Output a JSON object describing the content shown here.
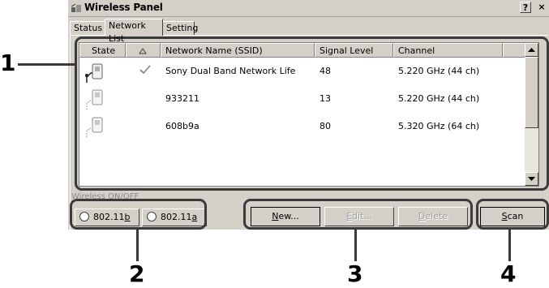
{
  "window": {
    "title": "Wireless Panel",
    "help_button": "?",
    "close_button": "×"
  },
  "tabs": [
    {
      "label": "Status",
      "active": false
    },
    {
      "label": "Network List",
      "active": true
    },
    {
      "label": "Setting",
      "active": false
    }
  ],
  "network_list": {
    "columns": [
      "State",
      "",
      "Network Name (SSID)",
      "Signal Level",
      "Channel"
    ],
    "rows": [
      {
        "state_icon": "connected-network-icon",
        "check": true,
        "ssid": "Sony Dual Band Network Life",
        "signal": "48",
        "channel": "5.220 GHz (44 ch)"
      },
      {
        "state_icon": "network-icon",
        "check": false,
        "ssid": "933211",
        "signal": "13",
        "channel": "5.220 GHz (44 ch)"
      },
      {
        "state_icon": "network-icon",
        "check": false,
        "ssid": "608b9a",
        "signal": "80",
        "channel": "5.320 GHz (64 ch)"
      }
    ]
  },
  "wireless_onoff": {
    "label": "Wireless ON/OFF",
    "options": [
      {
        "prefix": "802.11",
        "accel": "b"
      },
      {
        "prefix": "802.11",
        "accel": "a"
      }
    ]
  },
  "buttons": {
    "new": {
      "accel": "N",
      "rest": "ew..."
    },
    "edit": {
      "accel": "E",
      "rest": "dit..."
    },
    "delete": {
      "accel": "D",
      "rest": "elete"
    },
    "scan": {
      "accel": "S",
      "rest": "can"
    }
  },
  "callouts": [
    "1",
    "2",
    "3",
    "4"
  ],
  "colors": {
    "window_bg": "#d4d0c8",
    "callout": "#3a3a3a"
  }
}
